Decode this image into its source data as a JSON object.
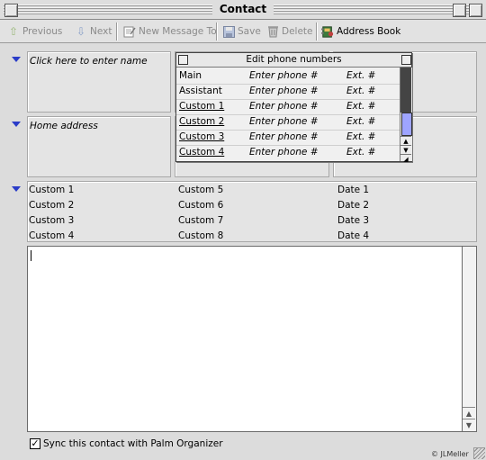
{
  "window": {
    "title": "Contact"
  },
  "toolbar": {
    "previous_label": "Previous",
    "next_label": "Next",
    "new_message_label": "New Message To",
    "save_label": "Save",
    "delete_label": "Delete",
    "address_book_label": "Address Book"
  },
  "name_section": {
    "name_placeholder": "Click here to enter name"
  },
  "address_section": {
    "address_placeholder": "Home address"
  },
  "phone_popup": {
    "title": "Edit phone numbers",
    "rows": [
      {
        "label": "Main",
        "phone": "Enter phone #",
        "ext": "Ext. #"
      },
      {
        "label": "Assistant",
        "phone": "Enter phone #",
        "ext": "Ext. #"
      },
      {
        "label": "Custom 1",
        "phone": "Enter phone #",
        "ext": "Ext. #"
      },
      {
        "label": "Custom 2",
        "phone": "Enter phone #",
        "ext": "Ext. #"
      },
      {
        "label": "Custom 3",
        "phone": "Enter phone #",
        "ext": "Ext. #"
      },
      {
        "label": "Custom 4",
        "phone": "Enter phone #",
        "ext": "Ext. #"
      }
    ]
  },
  "custom_section": {
    "col1": [
      "Custom 1",
      "Custom 2",
      "Custom 3",
      "Custom 4"
    ],
    "col2": [
      "Custom 5",
      "Custom 6",
      "Custom 7",
      "Custom 8"
    ],
    "col3": [
      "Date 1",
      "Date 2",
      "Date 3",
      "Date 4"
    ]
  },
  "notes": {
    "value": ""
  },
  "sync": {
    "label": "Sync this contact with Palm Organizer",
    "checked": true
  },
  "footer": {
    "credit": "© JLMeller"
  },
  "colors": {
    "accent_triangle": "#2a3cc8",
    "scroll_thumb": "#9ea4ff"
  }
}
